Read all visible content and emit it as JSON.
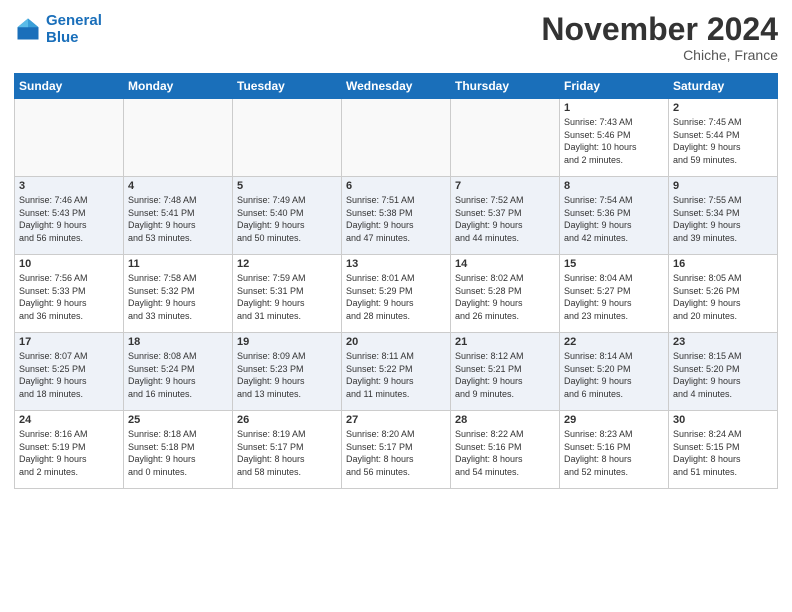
{
  "header": {
    "logo_line1": "General",
    "logo_line2": "Blue",
    "month": "November 2024",
    "location": "Chiche, France"
  },
  "days_of_week": [
    "Sunday",
    "Monday",
    "Tuesday",
    "Wednesday",
    "Thursday",
    "Friday",
    "Saturday"
  ],
  "weeks": [
    [
      {
        "day": "",
        "info": ""
      },
      {
        "day": "",
        "info": ""
      },
      {
        "day": "",
        "info": ""
      },
      {
        "day": "",
        "info": ""
      },
      {
        "day": "",
        "info": ""
      },
      {
        "day": "1",
        "info": "Sunrise: 7:43 AM\nSunset: 5:46 PM\nDaylight: 10 hours\nand 2 minutes."
      },
      {
        "day": "2",
        "info": "Sunrise: 7:45 AM\nSunset: 5:44 PM\nDaylight: 9 hours\nand 59 minutes."
      }
    ],
    [
      {
        "day": "3",
        "info": "Sunrise: 7:46 AM\nSunset: 5:43 PM\nDaylight: 9 hours\nand 56 minutes."
      },
      {
        "day": "4",
        "info": "Sunrise: 7:48 AM\nSunset: 5:41 PM\nDaylight: 9 hours\nand 53 minutes."
      },
      {
        "day": "5",
        "info": "Sunrise: 7:49 AM\nSunset: 5:40 PM\nDaylight: 9 hours\nand 50 minutes."
      },
      {
        "day": "6",
        "info": "Sunrise: 7:51 AM\nSunset: 5:38 PM\nDaylight: 9 hours\nand 47 minutes."
      },
      {
        "day": "7",
        "info": "Sunrise: 7:52 AM\nSunset: 5:37 PM\nDaylight: 9 hours\nand 44 minutes."
      },
      {
        "day": "8",
        "info": "Sunrise: 7:54 AM\nSunset: 5:36 PM\nDaylight: 9 hours\nand 42 minutes."
      },
      {
        "day": "9",
        "info": "Sunrise: 7:55 AM\nSunset: 5:34 PM\nDaylight: 9 hours\nand 39 minutes."
      }
    ],
    [
      {
        "day": "10",
        "info": "Sunrise: 7:56 AM\nSunset: 5:33 PM\nDaylight: 9 hours\nand 36 minutes."
      },
      {
        "day": "11",
        "info": "Sunrise: 7:58 AM\nSunset: 5:32 PM\nDaylight: 9 hours\nand 33 minutes."
      },
      {
        "day": "12",
        "info": "Sunrise: 7:59 AM\nSunset: 5:31 PM\nDaylight: 9 hours\nand 31 minutes."
      },
      {
        "day": "13",
        "info": "Sunrise: 8:01 AM\nSunset: 5:29 PM\nDaylight: 9 hours\nand 28 minutes."
      },
      {
        "day": "14",
        "info": "Sunrise: 8:02 AM\nSunset: 5:28 PM\nDaylight: 9 hours\nand 26 minutes."
      },
      {
        "day": "15",
        "info": "Sunrise: 8:04 AM\nSunset: 5:27 PM\nDaylight: 9 hours\nand 23 minutes."
      },
      {
        "day": "16",
        "info": "Sunrise: 8:05 AM\nSunset: 5:26 PM\nDaylight: 9 hours\nand 20 minutes."
      }
    ],
    [
      {
        "day": "17",
        "info": "Sunrise: 8:07 AM\nSunset: 5:25 PM\nDaylight: 9 hours\nand 18 minutes."
      },
      {
        "day": "18",
        "info": "Sunrise: 8:08 AM\nSunset: 5:24 PM\nDaylight: 9 hours\nand 16 minutes."
      },
      {
        "day": "19",
        "info": "Sunrise: 8:09 AM\nSunset: 5:23 PM\nDaylight: 9 hours\nand 13 minutes."
      },
      {
        "day": "20",
        "info": "Sunrise: 8:11 AM\nSunset: 5:22 PM\nDaylight: 9 hours\nand 11 minutes."
      },
      {
        "day": "21",
        "info": "Sunrise: 8:12 AM\nSunset: 5:21 PM\nDaylight: 9 hours\nand 9 minutes."
      },
      {
        "day": "22",
        "info": "Sunrise: 8:14 AM\nSunset: 5:20 PM\nDaylight: 9 hours\nand 6 minutes."
      },
      {
        "day": "23",
        "info": "Sunrise: 8:15 AM\nSunset: 5:20 PM\nDaylight: 9 hours\nand 4 minutes."
      }
    ],
    [
      {
        "day": "24",
        "info": "Sunrise: 8:16 AM\nSunset: 5:19 PM\nDaylight: 9 hours\nand 2 minutes."
      },
      {
        "day": "25",
        "info": "Sunrise: 8:18 AM\nSunset: 5:18 PM\nDaylight: 9 hours\nand 0 minutes."
      },
      {
        "day": "26",
        "info": "Sunrise: 8:19 AM\nSunset: 5:17 PM\nDaylight: 8 hours\nand 58 minutes."
      },
      {
        "day": "27",
        "info": "Sunrise: 8:20 AM\nSunset: 5:17 PM\nDaylight: 8 hours\nand 56 minutes."
      },
      {
        "day": "28",
        "info": "Sunrise: 8:22 AM\nSunset: 5:16 PM\nDaylight: 8 hours\nand 54 minutes."
      },
      {
        "day": "29",
        "info": "Sunrise: 8:23 AM\nSunset: 5:16 PM\nDaylight: 8 hours\nand 52 minutes."
      },
      {
        "day": "30",
        "info": "Sunrise: 8:24 AM\nSunset: 5:15 PM\nDaylight: 8 hours\nand 51 minutes."
      }
    ]
  ]
}
